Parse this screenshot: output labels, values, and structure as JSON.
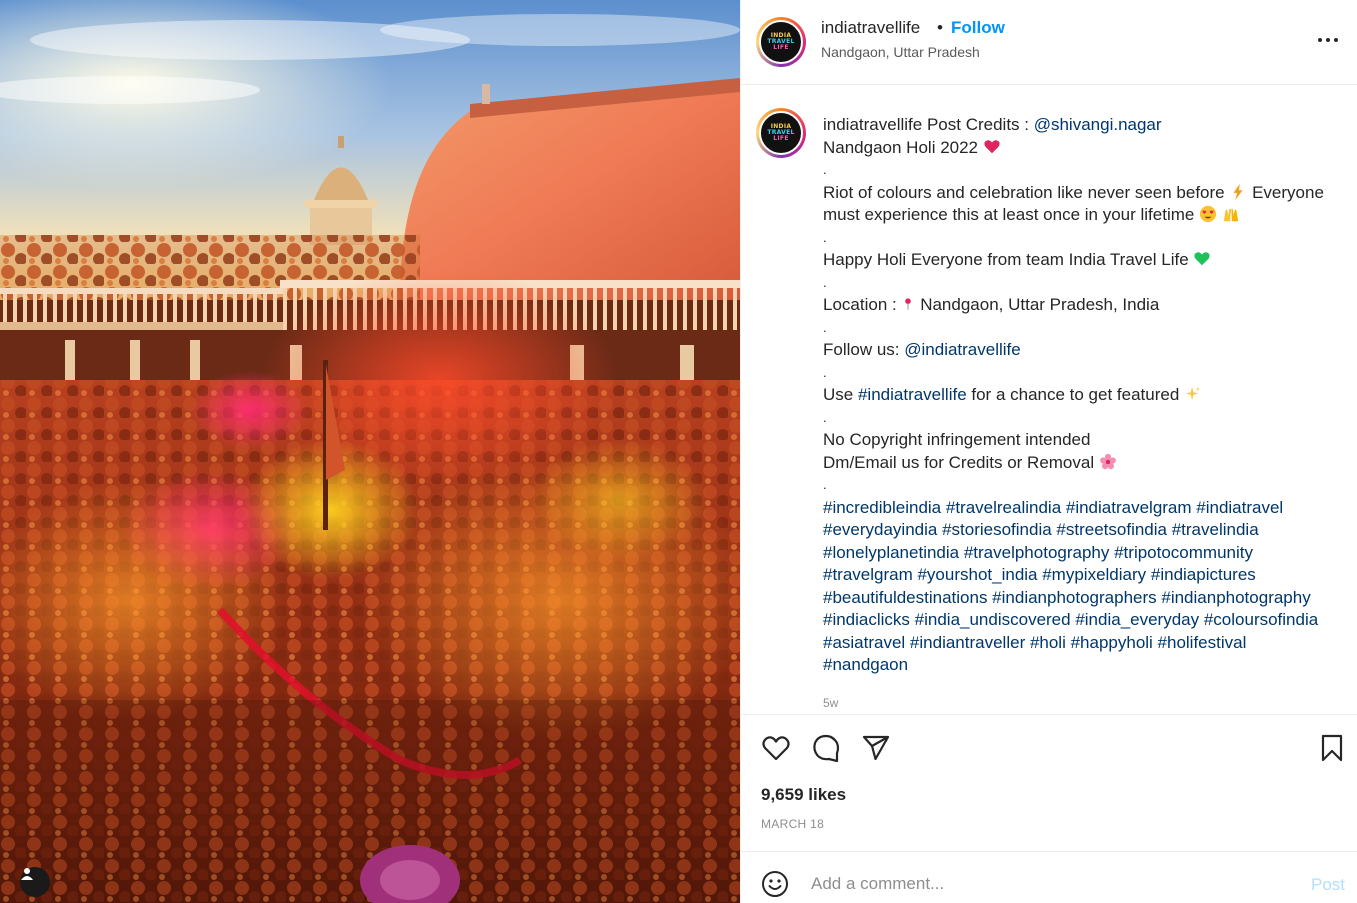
{
  "post": {
    "photo_alt": "",
    "user": {
      "username": "indiatravellife",
      "avatar_text": [
        "INDIA",
        "TRAVEL",
        "LIFE"
      ],
      "follow_label": "Follow",
      "separator": "•",
      "location": "Nandgaon, Uttar Pradesh"
    },
    "caption": {
      "username": "indiatravellife",
      "credits_prefix": " Post Credits : ",
      "credits_handle": "@shivangi.nagar",
      "title": "Nandgaon Holi 2022",
      "dot": ".",
      "line_riot": "Riot of colours and celebration like never seen before",
      "line_everyone_1": "Everyone",
      "line_everyone_2": "must experience this at least once in your lifetime",
      "line_happy": "Happy Holi Everyone from team India Travel Life",
      "location_prefix": "Location : ",
      "location_value": "Nandgaon, Uttar Pradesh, India",
      "follow_prefix": "Follow us: ",
      "follow_handle": "@indiatravellife",
      "use_prefix": "Use ",
      "use_hashtag": "#indiatravellife",
      "use_suffix": " for a chance to get featured",
      "copyright_1": "No Copyright infringement intended",
      "copyright_2": "Dm/Email us for Credits or Removal",
      "hashtag_lines": [
        "#incredibleindia #travelrealindia #indiatravelgram #indiatravel",
        "#everydayindia #storiesofindia #streetsofindia #travelindia",
        "#lonelyplanetindia #travelphotography #tripotocommunity",
        "#travelgram #yourshot_india #mypixeldiary #indiapictures",
        "#beautifuldestinations #indianphotographers #indianphotography",
        "#indiaclicks #india_undiscovered #india_everyday #coloursofindia",
        "#asiatravel #indiantraveller #holi #happyholi #holifestival",
        "#nandgaon"
      ],
      "age": "5w"
    },
    "likes": "9,659 likes",
    "date": "MARCH 18",
    "comment": {
      "placeholder": "Add a comment...",
      "value": "",
      "post_label": "Post"
    },
    "colors": {
      "link": "#00376b",
      "follow": "#0095f6",
      "post_disabled": "#b2dffc"
    },
    "icons": [
      "more-options-icon",
      "like-heart-icon",
      "comment-icon",
      "share-icon",
      "save-bookmark-icon",
      "emoji-icon",
      "user-tag-icon"
    ]
  }
}
